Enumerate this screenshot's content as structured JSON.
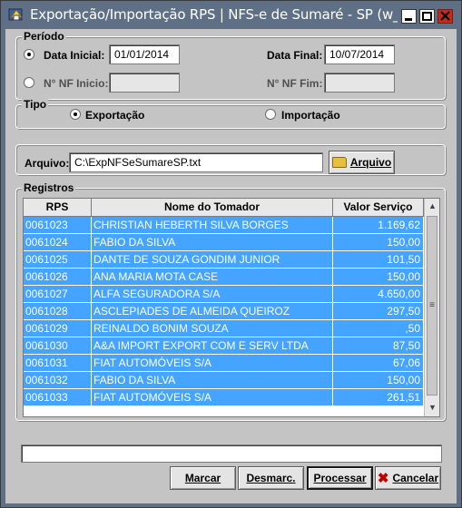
{
  "window": {
    "title": "Exportação/Importação RPS  |  NFS-e de Sumaré - SP (w_sef..."
  },
  "periodo": {
    "group_label": "Período",
    "data_inicial_label": "Data Inicial:",
    "data_inicial_value": "01/01/2014",
    "data_final_label": "Data Final:",
    "data_final_value": "10/07/2014",
    "nf_inicio_label": "N° NF Inicio:",
    "nf_inicio_value": "",
    "nf_fim_label": "N° NF Fim:",
    "nf_fim_value": ""
  },
  "tipo": {
    "group_label": "Tipo",
    "exportacao_label": "Exportação",
    "importacao_label": "Importação",
    "selected": "Exportação"
  },
  "arquivo": {
    "label": "Arquivo:",
    "value": "C:\\ExpNFSeSumareSP.txt",
    "button_label": "Arquivo"
  },
  "registros": {
    "group_label": "Registros",
    "columns": [
      "RPS",
      "Nome do Tomador",
      "Valor Serviço"
    ],
    "rows": [
      {
        "rps": "0061023",
        "nome": "CHRISTIAN HEBERTH SILVA  BORGES",
        "valor": "1.169,62"
      },
      {
        "rps": "0061024",
        "nome": "FABIO DA SILVA",
        "valor": "150,00"
      },
      {
        "rps": "0061025",
        "nome": "DANTE DE SOUZA GONDIM JUNIOR",
        "valor": "101,50"
      },
      {
        "rps": "0061026",
        "nome": "ANA MARIA MOTA CASE",
        "valor": "150,00"
      },
      {
        "rps": "0061027",
        "nome": "ALFA SEGURADORA S/A",
        "valor": "4.650,00"
      },
      {
        "rps": "0061028",
        "nome": "ASCLEPIADES DE ALMEIDA QUEIROZ",
        "valor": "297,50"
      },
      {
        "rps": "0061029",
        "nome": "REINALDO BONIM SOUZA",
        "valor": ",50"
      },
      {
        "rps": "0061030",
        "nome": "A&A IMPORT EXPORT COM E SERV LTDA",
        "valor": "87,50"
      },
      {
        "rps": "0061031",
        "nome": "FIAT AUTOMÓVEIS S/A",
        "valor": "67,06"
      },
      {
        "rps": "0061032",
        "nome": "FABIO DA SILVA",
        "valor": "150,00"
      },
      {
        "rps": "0061033",
        "nome": "FIAT AUTOMÓVEIS S/A",
        "valor": "261,51"
      }
    ]
  },
  "footer": {
    "status_text": "",
    "marcar_label": "Marcar",
    "desmarc_label": "Desmarc.",
    "processar_label": "Processar",
    "cancelar_label": "Cancelar"
  },
  "colors": {
    "titlebar": "#5f6f86",
    "dialog_bg": "#c4c4c4",
    "row_selected": "#44a4ff",
    "close_button": "#c42b1c"
  },
  "icons": {
    "app": "app-icon",
    "minimize": "minimize-icon",
    "maximize": "maximize-icon",
    "close": "close-icon",
    "folder": "folder-open-icon",
    "cancel": "x-mark-icon"
  }
}
